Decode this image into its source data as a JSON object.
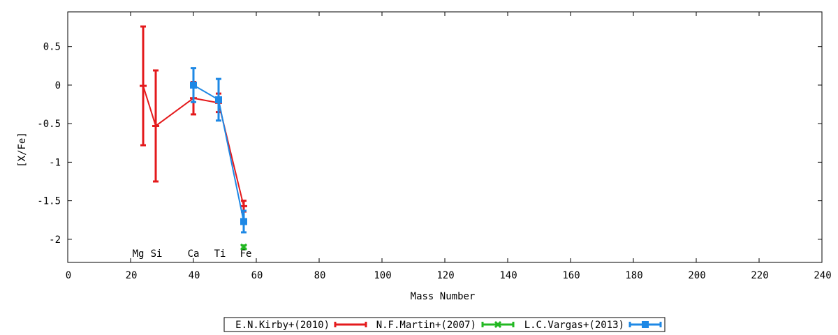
{
  "chart_data": {
    "type": "line",
    "title": "",
    "xlabel": "Mass Number",
    "ylabel": "[X/Fe]",
    "xlim": [
      0,
      240
    ],
    "ylim": [
      -2.3,
      0.95
    ],
    "xticks": [
      0,
      20,
      40,
      60,
      80,
      100,
      120,
      140,
      160,
      180,
      200,
      220,
      240
    ],
    "yticks": [
      0.5,
      0,
      -0.5,
      -1,
      -1.5,
      -2
    ],
    "ytick_labels": [
      "0.5",
      "0",
      "-0.5",
      "-1",
      "-1.5",
      "-2"
    ],
    "grid": false,
    "legend_placement": "bottom-center",
    "element_labels": [
      {
        "label": "Mg",
        "x": 24
      },
      {
        "label": "Si",
        "x": 28
      },
      {
        "label": "Ca",
        "x": 40
      },
      {
        "label": "Ti",
        "x": 48
      },
      {
        "label": "Fe",
        "x": 56
      }
    ],
    "series": [
      {
        "name": "E.N.Kirby+(2010)",
        "color": "#e41a1c",
        "marker": "dash",
        "points": [
          {
            "x": 24,
            "y": -0.01,
            "err": 0.77
          },
          {
            "x": 28,
            "y": -0.53,
            "err": 0.72
          },
          {
            "x": 40,
            "y": -0.17,
            "err": 0.21
          },
          {
            "x": 48,
            "y": -0.23,
            "err": 0.12
          },
          {
            "x": 56,
            "y": -1.57,
            "err": 0.07
          }
        ]
      },
      {
        "name": "N.F.Martin+(2007)",
        "color": "#22b822",
        "marker": "x",
        "points": [
          {
            "x": 56,
            "y": -2.1,
            "err": 0.02
          }
        ]
      },
      {
        "name": "L.C.Vargas+(2013)",
        "color": "#1e88e5",
        "marker": "square",
        "points": [
          {
            "x": 40,
            "y": 0.0,
            "err": 0.22
          },
          {
            "x": 48,
            "y": -0.19,
            "err": 0.27
          },
          {
            "x": 56,
            "y": -1.77,
            "err": 0.14
          }
        ]
      }
    ]
  }
}
